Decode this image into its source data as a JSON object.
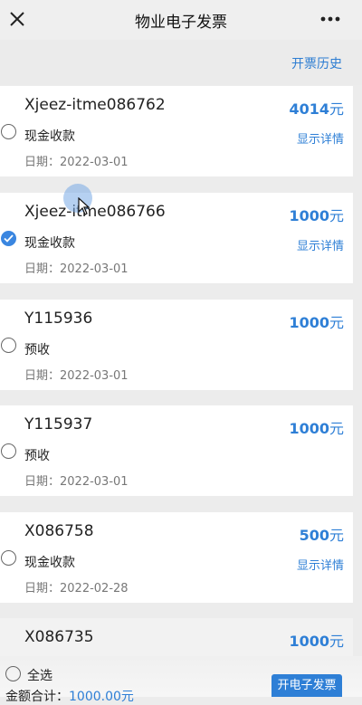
{
  "header": {
    "title": "物业电子发票"
  },
  "subbar": {
    "history_label": "开票历史"
  },
  "invoices": [
    {
      "code": "Xjeez-itme086762",
      "amount": "4014",
      "unit": "元",
      "payment_type": "现金收款",
      "detail_label": "显示详情",
      "date": "日期：2022-03-01",
      "selected": false
    },
    {
      "code": "Xjeez-itme086766",
      "amount": "1000",
      "unit": "元",
      "payment_type": "现金收款",
      "detail_label": "显示详情",
      "date": "日期：2022-03-01",
      "selected": true
    },
    {
      "code": "Y115936",
      "amount": "1000",
      "unit": "元",
      "payment_type": "预收",
      "detail_label": "",
      "date": "日期：2022-03-01",
      "selected": false
    },
    {
      "code": "Y115937",
      "amount": "1000",
      "unit": "元",
      "payment_type": "预收",
      "detail_label": "",
      "date": "日期：2022-03-01",
      "selected": false
    },
    {
      "code": "X086758",
      "amount": "500",
      "unit": "元",
      "payment_type": "现金收款",
      "detail_label": "显示详情",
      "date": "日期：2022-02-28",
      "selected": false
    },
    {
      "code": "X086735",
      "amount": "1000",
      "unit": "元"
    }
  ],
  "footer": {
    "select_all_label": "全选",
    "total_label": "金额合计：",
    "total_value": "1000.00元",
    "issue_button_label": "开电子发票"
  },
  "colors": {
    "accent": "#2e7fd6"
  }
}
